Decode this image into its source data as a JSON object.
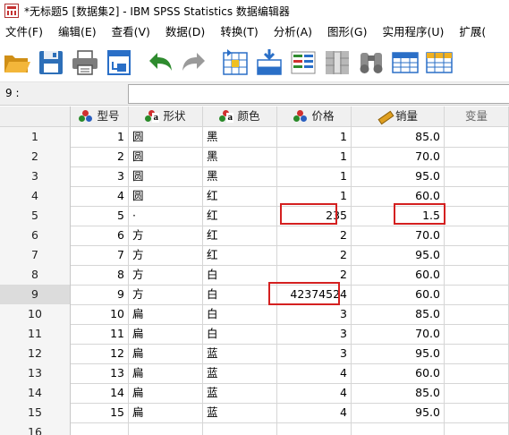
{
  "window": {
    "title": "*无标题5 [数据集2] - IBM SPSS Statistics 数据编辑器"
  },
  "menu": [
    "文件(F)",
    "编辑(E)",
    "查看(V)",
    "数据(D)",
    "转换(T)",
    "分析(A)",
    "图形(G)",
    "实用程序(U)",
    "扩展("
  ],
  "toolbar": {
    "icons": [
      "open-folder-icon",
      "save-icon",
      "print-icon",
      "dialog-recall-icon",
      "undo-icon",
      "redo-icon",
      "goto-case-icon",
      "goto-variable-icon",
      "variables-icon",
      "run-descriptives-icon",
      "find-icon",
      "insert-cases-icon",
      "insert-variable-icon"
    ],
    "colors": {
      "undo": "#2e8b2e",
      "redo": "#9a9a9a",
      "folder": "#e8a626",
      "accent": "#2a6fc7"
    }
  },
  "cell_reference": {
    "label": "9 :",
    "value": ""
  },
  "columns": [
    {
      "name": "型号",
      "icon": "nominal-icon"
    },
    {
      "name": "形状",
      "icon": "string-nominal-icon"
    },
    {
      "name": "颜色",
      "icon": "string-nominal-icon"
    },
    {
      "name": "价格",
      "icon": "nominal-icon"
    },
    {
      "name": "销量",
      "icon": "scale-icon"
    },
    {
      "name": "变量",
      "icon": ""
    }
  ],
  "rows": [
    {
      "num": "1",
      "values": [
        "1",
        "圆",
        "黑",
        "1",
        "85.0",
        ""
      ]
    },
    {
      "num": "2",
      "values": [
        "2",
        "圆",
        "黑",
        "1",
        "70.0",
        ""
      ]
    },
    {
      "num": "3",
      "values": [
        "3",
        "圆",
        "黑",
        "1",
        "95.0",
        ""
      ]
    },
    {
      "num": "4",
      "values": [
        "4",
        "圆",
        "红",
        "1",
        "60.0",
        ""
      ]
    },
    {
      "num": "5",
      "values": [
        "5",
        "·",
        "红",
        "235",
        "1.5",
        ""
      ]
    },
    {
      "num": "6",
      "values": [
        "6",
        "方",
        "红",
        "2",
        "70.0",
        ""
      ]
    },
    {
      "num": "7",
      "values": [
        "7",
        "方",
        "红",
        "2",
        "95.0",
        ""
      ]
    },
    {
      "num": "8",
      "values": [
        "8",
        "方",
        "白",
        "2",
        "60.0",
        ""
      ]
    },
    {
      "num": "9",
      "values": [
        "9",
        "方",
        "白",
        "42374524",
        "60.0",
        ""
      ]
    },
    {
      "num": "10",
      "values": [
        "10",
        "扁",
        "白",
        "3",
        "85.0",
        ""
      ]
    },
    {
      "num": "11",
      "values": [
        "11",
        "扁",
        "白",
        "3",
        "70.0",
        ""
      ]
    },
    {
      "num": "12",
      "values": [
        "12",
        "扁",
        "蓝",
        "3",
        "95.0",
        ""
      ]
    },
    {
      "num": "13",
      "values": [
        "13",
        "扁",
        "蓝",
        "4",
        "60.0",
        ""
      ]
    },
    {
      "num": "14",
      "values": [
        "14",
        "扁",
        "蓝",
        "4",
        "85.0",
        ""
      ]
    },
    {
      "num": "15",
      "values": [
        "15",
        "扁",
        "蓝",
        "4",
        "95.0",
        ""
      ]
    },
    {
      "num": "16",
      "values": [
        "",
        "",
        "",
        "",
        "",
        ""
      ]
    }
  ],
  "selected_row": "9",
  "highlight_color": "#d42020"
}
